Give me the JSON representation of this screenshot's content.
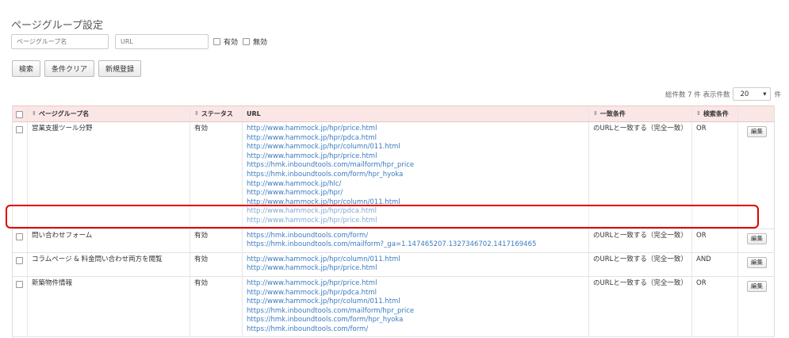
{
  "page": {
    "title": "ページグループ設定"
  },
  "filters": {
    "name_placeholder": "ページグループ名",
    "url_placeholder": "URL",
    "active_label": "有効",
    "inactive_label": "無効"
  },
  "buttons": {
    "search": "検索",
    "clear": "条件クリア",
    "new": "新規登録"
  },
  "pager": {
    "total": "総件数 7 件 表示件数",
    "per_page": "20",
    "unit": "件"
  },
  "table": {
    "headers": {
      "name": "ページグループ名",
      "status": "ステータス",
      "url": "URL",
      "match": "一致条件",
      "condition": "検索条件"
    },
    "edit_label": "編集",
    "rows": [
      {
        "name": "営業支援ツール分野",
        "status": "有効",
        "urls": [
          "http://www.hammock.jp/hpr/price.html",
          "http://www.hammock.jp/hpr/pdca.html",
          "http://www.hammock.jp/hpr/column/011.html",
          "http://www.hammock.jp/hpr/price.html",
          "https://hmk.inboundtools.com/mailform/hpr_price",
          "https://hmk.inboundtools.com/form/hpr_hyoka",
          "http://www.hammock.jp/hlc/",
          "http://www.hammock.jp/hpr/",
          "http://www.hammock.jp/hpr/column/011.html",
          "http://www.hammock.jp/hpr/pdca.html",
          "http://www.hammock.jp/hpr/price.html"
        ],
        "match": "のURLと一致する（完全一致）",
        "condition": "OR"
      },
      {
        "name": "問い合わせフォーム",
        "status": "有効",
        "urls": [
          "https://hmk.inboundtools.com/form/",
          "https://hmk.inboundtools.com/mailform?_ga=1.147465207.1327346702.1417169465"
        ],
        "match": "のURLと一致する（完全一致）",
        "condition": "OR"
      },
      {
        "name": "コラムページ & 料金問い合わせ両方を閲覧",
        "status": "有効",
        "urls": [
          "http://www.hammock.jp/hpr/column/011.html",
          "http://www.hammock.jp/hpr/price.html"
        ],
        "match": "のURLと一致する（完全一致）",
        "condition": "AND"
      },
      {
        "name": "新築物件情報",
        "status": "有効",
        "urls": [
          "http://www.hammock.jp/hpr/price.html",
          "http://www.hammock.jp/hpr/pdca.html",
          "http://www.hammock.jp/hpr/column/011.html",
          "https://hmk.inboundtools.com/mailform/hpr_price",
          "https://hmk.inboundtools.com/form/hpr_hyoka",
          "https://hmk.inboundtools.com/form/"
        ],
        "match": "のURLと一致する（完全一致）",
        "condition": "OR"
      }
    ]
  }
}
